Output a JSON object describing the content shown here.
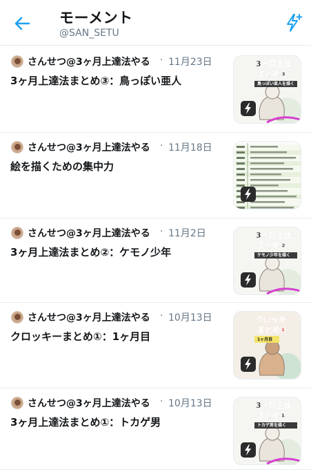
{
  "header": {
    "title": "モーメント",
    "handle": "@SAN_SETU"
  },
  "colors": {
    "accent": "#1da1f2",
    "text": "#14171a",
    "muted": "#657786",
    "divider": "#e6ecf0"
  },
  "moments": [
    {
      "author": "さんせつ@3ヶ月上達法やる",
      "date": "11月23日",
      "title": "3ヶ月上達法まとめ③：鳥っぽい亜人",
      "thumb_text": [
        "3ヶ月上達",
        "まとめ③",
        "鳥っぽい亜人を描く"
      ]
    },
    {
      "author": "さんせつ@3ヶ月上達法やる",
      "date": "11月18日",
      "title": "絵を描くための集中力",
      "thumb_text": []
    },
    {
      "author": "さんせつ@3ヶ月上達法やる",
      "date": "11月2日",
      "title": "3ヶ月上達法まとめ②：ケモノ少年",
      "thumb_text": [
        "3ヶ月上達",
        "まとめ②",
        "ケモノ少年を描く"
      ]
    },
    {
      "author": "さんせつ@3ヶ月上達法やる",
      "date": "10月13日",
      "title": "クロッキーまとめ①：1ヶ月目",
      "thumb_text": [
        "クロッキー",
        "まとめ①",
        "1ヶ月目"
      ]
    },
    {
      "author": "さんせつ@3ヶ月上達法やる",
      "date": "10月13日",
      "title": "3ヶ月上達法まとめ①：トカゲ男",
      "thumb_text": [
        "3ヶ月上達",
        "まとめ①",
        "トカゲ男を描く"
      ]
    }
  ],
  "icons": {
    "back": "arrow-left-icon",
    "create": "lightning-plus-icon",
    "moment": "lightning-icon"
  }
}
